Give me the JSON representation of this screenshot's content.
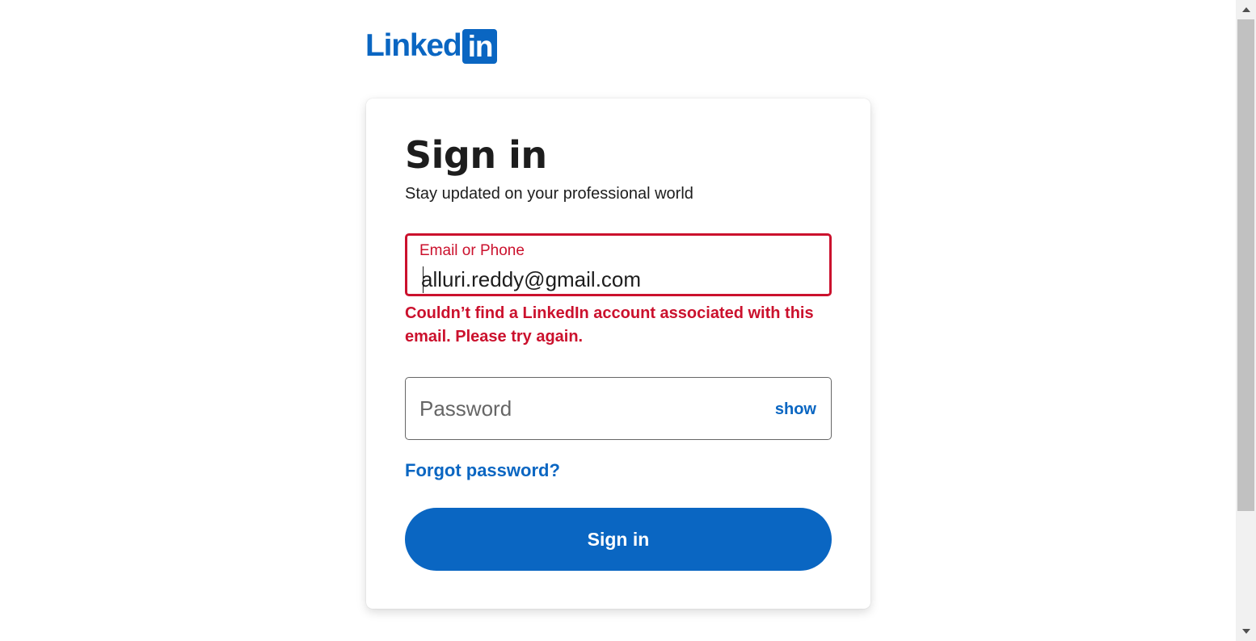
{
  "brand": {
    "logo_word": "Linked",
    "logo_box": "in",
    "color": "#0a66c2"
  },
  "card": {
    "title": "Sign in",
    "subtitle": "Stay updated on your professional world"
  },
  "email_field": {
    "label": "Email or Phone",
    "value": "alluri.reddy@gmail.com",
    "error": "Couldn’t find a LinkedIn account associated with this email. Please try again.",
    "error_color": "#cb112d"
  },
  "password_field": {
    "placeholder": "Password",
    "value": "",
    "toggle_label": "show"
  },
  "links": {
    "forgot_password": "Forgot password?"
  },
  "actions": {
    "sign_in_label": "Sign in"
  },
  "icons": {
    "scroll_up": "triangle-up-icon",
    "scroll_down": "triangle-down-icon"
  }
}
